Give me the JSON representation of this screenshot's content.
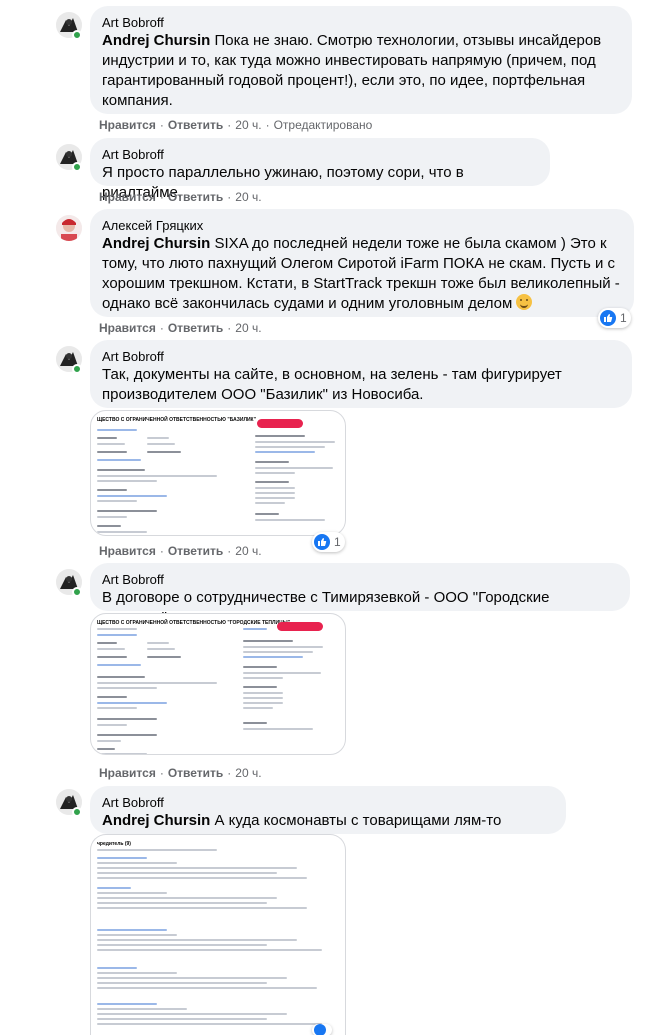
{
  "comments": [
    {
      "author": "Art Bobroff",
      "mention": "Andrej Chursin",
      "text": " Пока не знаю. Смотрю технологии, отзывы инсайдеров индустрии и то, как туда можно инвестировать напрямую (причем, под гарантированный годовой процент!), если это, по идее, портфельная компания.",
      "like": "Нравится",
      "reply": "Ответить",
      "time": "20 ч.",
      "edited": "Отредактировано"
    },
    {
      "author": "Art Bobroff",
      "text": "Я просто параллельно ужинаю, поэтому сори, что в риалтайме.",
      "like": "Нравится",
      "reply": "Ответить",
      "time": "20 ч."
    },
    {
      "author": "Алексей Гряцких",
      "mention": "Andrej Chursin",
      "text": " SIXA до последней недели тоже не была скамом ) Это к тому, что люто пахнущий Олегом Сиротой iFarm ПОКА не скам. Пусть и с хорошим трекшном. Кстати, в StartTrack трекшн тоже был великолепный - однако всё закончилась судами и одним уголовным делом ",
      "like": "Нравится",
      "reply": "Ответить",
      "time": "20 ч.",
      "reactions": "1"
    },
    {
      "author": "Art Bobroff",
      "text": "Так, документы на сайте, в основном, на зелень - там фигурирует производителем ООО \"Базилик\" из Новосиба.",
      "like": "Нравится",
      "reply": "Ответить",
      "time": "20 ч.",
      "reactions": "1",
      "doc_title": "ЩЕСТВО С ОГРАНИЧЕННОЙ ОТВЕТСТВЕННОСТЬЮ \"БАЗИЛИК\""
    },
    {
      "author": "Art Bobroff",
      "text": "В договоре о сотрудничестве с Тимирязевкой - ООО \"Городские теплицы\".",
      "like": "Нравится",
      "reply": "Ответить",
      "time": "20 ч.",
      "doc_title": "ЩЕСТВО С ОГРАНИЧЕННОЙ ОТВЕТСТВЕННОСТЬЮ \"ГОРОДСКИЕ ТЕПЛИЦЫ\""
    },
    {
      "author": "Art Bobroff",
      "mention": "Andrej Chursin",
      "text": " А куда космонавты с товарищами лям-то вкатили?",
      "doc_title": "чредитель (9)"
    }
  ],
  "colors": {
    "bubble": "#f0f2f5",
    "meta": "#65676b",
    "like": "#1877f2",
    "online": "#31a24c"
  }
}
